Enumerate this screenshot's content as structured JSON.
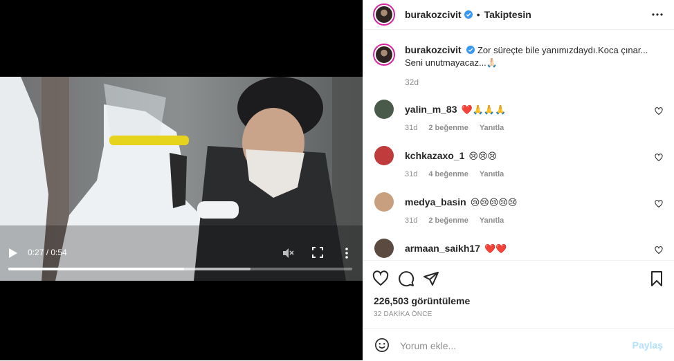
{
  "video": {
    "time_label": "0:27 / 0:54",
    "played_fraction": 0.512,
    "buffered_fraction": 0.705
  },
  "header": {
    "username": "burakozcivit",
    "separator": "•",
    "follow_state": "Takiptesin"
  },
  "caption": {
    "username": "burakozcivit",
    "text": "Zor süreçte bile yanımızdaydı.Koca çınar... Seni unutmayacaz...🙏🏻",
    "time": "32d"
  },
  "comments": [
    {
      "username": "yalin_m_83",
      "text": "❤️🙏🙏🙏",
      "time": "31d",
      "likes": "2 beğenme",
      "reply": "Yanıtla"
    },
    {
      "username": "kchkazaxo_1",
      "text": "😢😢😢",
      "time": "31d",
      "likes": "4 beğenme",
      "reply": "Yanıtla"
    },
    {
      "username": "medya_basin",
      "text": "😢😢😢😢😢",
      "time": "31d",
      "likes": "2 beğenme",
      "reply": "Yanıtla"
    },
    {
      "username": "armaan_saikh17",
      "text": "❤️❤️",
      "time": "",
      "likes": "",
      "reply": ""
    }
  ],
  "stats": {
    "views": "226,503 görüntüleme",
    "ago": "32 DAKİKA ÖNCE"
  },
  "add_comment": {
    "placeholder": "Yorum ekle...",
    "post_label": "Paylaş"
  },
  "colors": {
    "verified": "#3897f0",
    "like_heart": "#ed4956",
    "post_disabled": "#b2dffc",
    "avatar_ring": "#d6249f"
  }
}
